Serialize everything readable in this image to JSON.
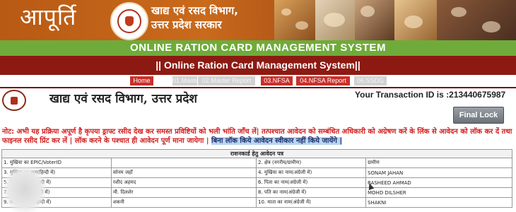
{
  "header": {
    "brand": "आपूर्ति",
    "dept_line1": "खाद्य एवं रसद विभाग,",
    "dept_line2": "उत्तर प्रदेश सरकार"
  },
  "banner_title": "ONLINE RATION CARD MANAGEMENT SYSTEM",
  "sub_title": "|| Online Ration Card Management System||",
  "tabs": [
    "Home",
    "01.Master",
    "02.Master Report",
    "03.NFSA",
    "04.NFSA Report",
    "06.SSDG"
  ],
  "form": {
    "heading": "खाद्य एवं रसद विभाग, उत्तर प्रदेश",
    "transaction_label": "Your Transaction ID is :",
    "transaction_id": "213440675987",
    "final_lock": "Final Lock",
    "note_red": "नोट: अभी यह प्रक्रिया अपूर्ण है कृपया ड्राफ्ट रसीद देख कर समस्त प्रविष्टियों को भली भांति जाँच लें| तत्पश्चात आवेदन को सम्बंधित अधिकारी को अग्रेषण करें के लिंक से आवेदन को लॉक कर दें तथा फाइनल रसीद प्रिंट कर लें | लॉक करने के पश्चात ही आवेदन पूर्ण माना जायेगा |",
    "note_highlight": "बिना लॉक किये आवेदन स्वीकार नहीं किये जायेंगे |",
    "table_caption": "राशनकार्ड हेतु आवेदन पत्र",
    "rows": [
      {
        "l_label": "1. मुखिया का EPIC/VoterID",
        "l_value": "",
        "r_label": "2. क्षेत्र (नगरीय/ग्रामीण)",
        "r_value": "ग्रामीण"
      },
      {
        "l_label": "3. मुखिया का नाम(हिन्दी में)",
        "l_value": "सोनम जहाँ",
        "r_label": "4. मुखिया का नाम(अंग्रेजी में)",
        "r_value": "SONAM JAHAN"
      },
      {
        "l_label": "5. पिता का नाम(हिन्दी में)",
        "l_value": "रशीद अहमद",
        "r_label": "6. पिता का नाम(अंग्रेजी में)",
        "r_value": "RASHEED AHMAD"
      },
      {
        "l_label": "7. पति का नाम(हिन्दी में)",
        "l_value": "मौ. दिलशेर",
        "r_label": "8. पति का नाम(अंग्रेजी में)",
        "r_value": "MOHD DILSHER"
      },
      {
        "l_label": "9. माता का नाम(हिन्दी में)",
        "l_value": "शकनी",
        "r_label": "10. माता का नाम(अंग्रेजी में)",
        "r_value": "SHAKNI"
      }
    ]
  },
  "colors": {
    "banner": "#c96a1c",
    "green_band": "#6fab3a",
    "maroon_band": "#8c1a12",
    "tab_red": "#c9302a",
    "note_red": "#d21e1e"
  }
}
